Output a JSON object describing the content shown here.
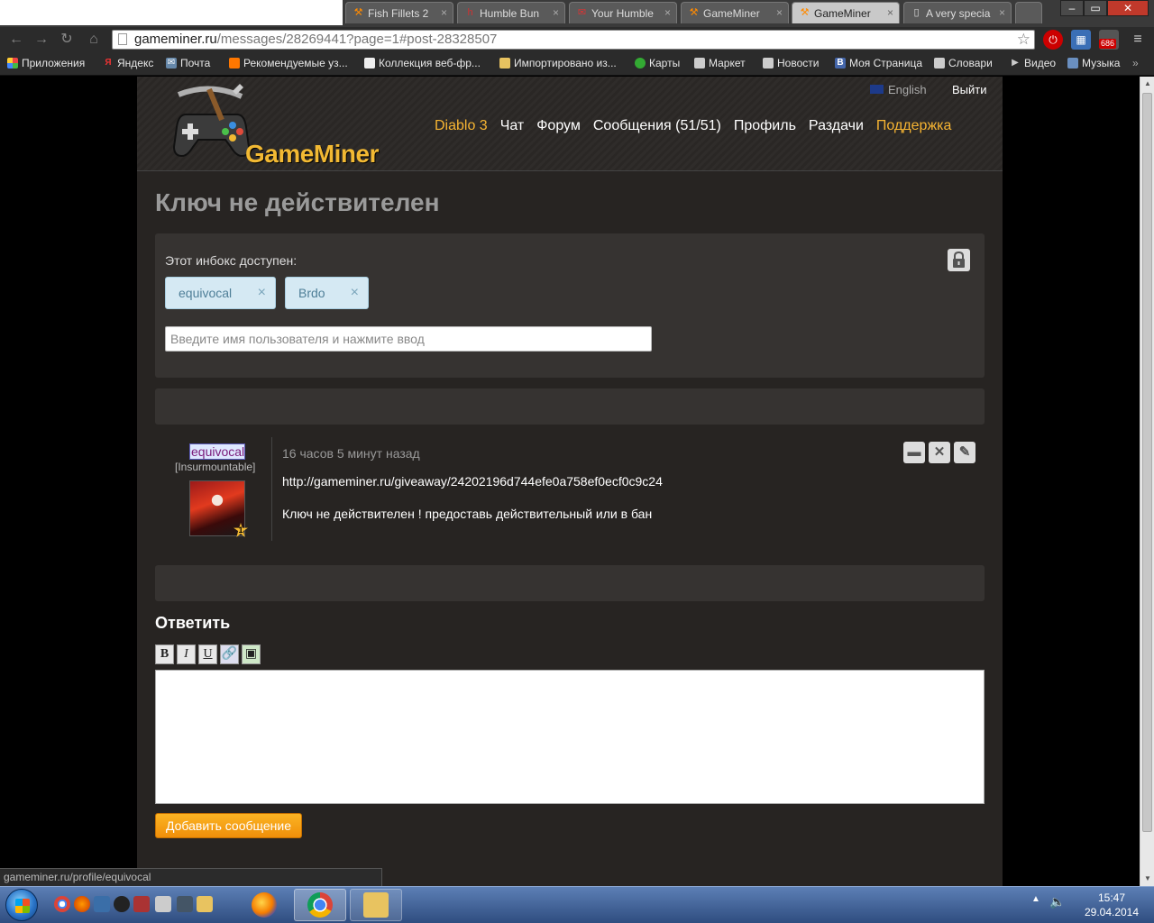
{
  "browser": {
    "tabs": [
      {
        "title": "Fish Fillets 2",
        "icon": "gameminer-favicon-icon"
      },
      {
        "title": "Humble Bun",
        "icon": "humble-favicon-icon"
      },
      {
        "title": "Your Humble",
        "icon": "gmail-favicon-icon"
      },
      {
        "title": "GameMiner",
        "icon": "gameminer-favicon-icon"
      },
      {
        "title": "GameMiner",
        "icon": "gameminer-favicon-icon",
        "active": true
      },
      {
        "title": "A very specia",
        "icon": "page-favicon-icon"
      }
    ],
    "url_host": "gameminer.ru",
    "url_path": "/messages/28269441?page=1#post-28328507",
    "extension_badge": "686",
    "bookmarks": [
      "Приложения",
      "Яндекс",
      "Почта",
      "Рекомендуемые уз...",
      "Коллекция веб-фр...",
      "Импортировано из...",
      "Карты",
      "Маркет",
      "Новости",
      "Моя Страница",
      "Словари",
      "Видео",
      "Музыка"
    ],
    "status_url": "gameminer.ru/profile/equivocal"
  },
  "site": {
    "logo_text": "GameMiner",
    "lang_label": "English",
    "logout_label": "Выйти",
    "nav": [
      {
        "label": "Diablo 3",
        "highlight": true
      },
      {
        "label": "Чат",
        "highlight": false
      },
      {
        "label": "Форум",
        "highlight": false
      },
      {
        "label": "Сообщения (51/51)",
        "highlight": false
      },
      {
        "label": "Профиль",
        "highlight": false
      },
      {
        "label": "Раздачи",
        "highlight": false
      },
      {
        "label": "Поддержка",
        "highlight": true
      }
    ],
    "accent_color": "#f6b432"
  },
  "thread": {
    "title": "Ключ не действителен",
    "access_label": "Этот инбокс доступен:",
    "participants": [
      "equivocal",
      "Brdo"
    ],
    "remove_symbol": "×",
    "user_input_placeholder": "Введите имя пользователя и нажмите ввод"
  },
  "post": {
    "author": "equivocal",
    "rank": "[Insurmountable]",
    "level": "1",
    "time": "16 часов 5 минут назад",
    "link": "http://gameminer.ru/giveaway/24202196d744efe0a758ef0ecf0c9c24",
    "text": "Ключ не действителен ! предоставь действительный или в бан"
  },
  "reply": {
    "title": "Ответить",
    "bold": "B",
    "italic": "I",
    "underline": "U",
    "submit_label": "Добавить сообщение"
  },
  "taskbar": {
    "time": "15:47",
    "date": "29.04.2014"
  }
}
